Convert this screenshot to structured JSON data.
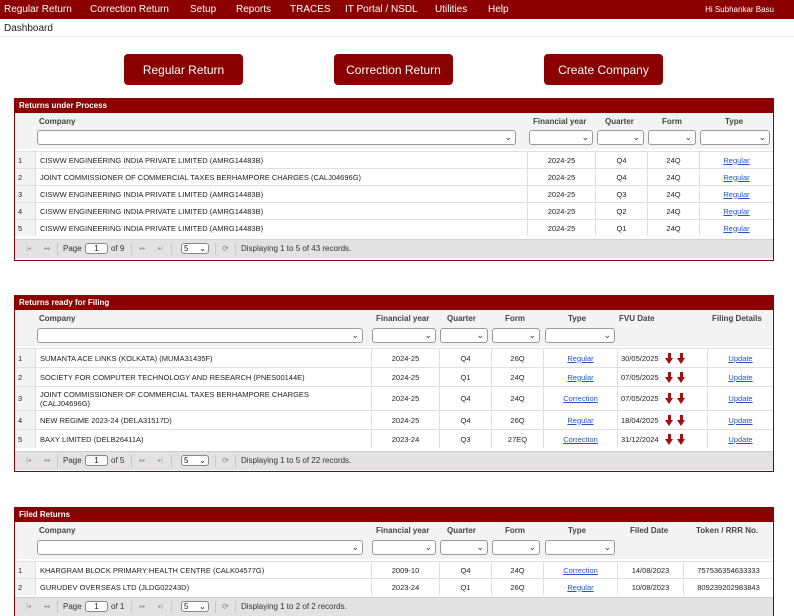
{
  "menu": {
    "items": [
      "Regular Return",
      "Correction Return",
      "Setup",
      "Reports",
      "TRACES",
      "IT Portal / NSDL",
      "Utilities",
      "Help"
    ],
    "user": "Hi Subhankar Basu"
  },
  "breadcrumb": "Dashboard",
  "buttons": {
    "regular": "Regular Return",
    "correction": "Correction Return",
    "create": "Create Company"
  },
  "icons": {
    "dropdown": "chevron-down-icon",
    "fvu_download": "download-arrow-icon",
    "refresh": "refresh-icon"
  },
  "colors": {
    "brand": "#8b0000",
    "link": "#2255cc"
  },
  "pager_icons": [
    "|◂",
    "◂◂",
    "▸▸",
    "▸|",
    "⟳"
  ],
  "chevron": "⌄",
  "process": {
    "title": "Returns under Process",
    "headers": {
      "company": "Company",
      "fy": "Financial year",
      "quarter": "Quarter",
      "form": "Form",
      "type": "Type"
    },
    "rows": [
      {
        "n": "1",
        "company": "CISWW ENGINEERING INDIA PRIVATE LIMITED (AMRG14483B)",
        "fy": "2024-25",
        "q": "Q4",
        "form": "24Q",
        "type": "Regular"
      },
      {
        "n": "2",
        "company": "JOINT COMMISSIONER OF COMMERCIAL TAXES BERHAMPORE CHARGES (CALJ04696G)",
        "fy": "2024-25",
        "q": "Q4",
        "form": "24Q",
        "type": "Regular"
      },
      {
        "n": "3",
        "company": "CISWW ENGINEERING INDIA PRIVATE LIMITED (AMRG14483B)",
        "fy": "2024-25",
        "q": "Q3",
        "form": "24Q",
        "type": "Regular"
      },
      {
        "n": "4",
        "company": "CISWW ENGINEERING INDIA PRIVATE LIMITED (AMRG14483B)",
        "fy": "2024-25",
        "q": "Q2",
        "form": "24Q",
        "type": "Regular"
      },
      {
        "n": "5",
        "company": "CISWW ENGINEERING INDIA PRIVATE LIMITED (AMRG14483B)",
        "fy": "2024-25",
        "q": "Q1",
        "form": "24Q",
        "type": "Regular"
      }
    ],
    "pager": {
      "page_label": "Page",
      "page": "1",
      "of": "of 9",
      "size": "5",
      "status": "Displaying 1 to 5 of 43 records."
    }
  },
  "filing": {
    "title": "Returns ready for Filing",
    "headers": {
      "company": "Company",
      "fy": "Financial year",
      "quarter": "Quarter",
      "form": "Form",
      "type": "Type",
      "fvu": "FVU Date",
      "details": "Filing Details"
    },
    "rows": [
      {
        "n": "1",
        "company": "SUMANTA ACE LINKS (KOLKATA) (MUMA31435F)",
        "fy": "2024-25",
        "q": "Q4",
        "form": "26Q",
        "type": "Regular",
        "fvu": "30/05/2025",
        "details": "Update"
      },
      {
        "n": "2",
        "company": "SOCIETY FOR COMPUTER TECHNOLOGY AND RESEARCH (PNES00144E)",
        "fy": "2024-25",
        "q": "Q1",
        "form": "24Q",
        "type": "Regular",
        "fvu": "07/05/2025",
        "details": "Update"
      },
      {
        "n": "3",
        "company": "JOINT COMMISSIONER OF COMMERCIAL TAXES BERHAMPORE CHARGES (CALJ04696G)",
        "fy": "2024-25",
        "q": "Q4",
        "form": "24Q",
        "type": "Correction",
        "fvu": "07/05/2025",
        "details": "Update"
      },
      {
        "n": "4",
        "company": "NEW REGIME 2023-24 (DELA31517D)",
        "fy": "2024-25",
        "q": "Q4",
        "form": "26Q",
        "type": "Regular",
        "fvu": "18/04/2025",
        "details": "Update"
      },
      {
        "n": "5",
        "company": "BAXY LIMITED (DELB26411A)",
        "fy": "2023-24",
        "q": "Q3",
        "form": "27EQ",
        "type": "Correction",
        "fvu": "31/12/2024",
        "details": "Update"
      }
    ],
    "pager": {
      "page_label": "Page",
      "page": "1",
      "of": "of 5",
      "size": "5",
      "status": "Displaying 1 to 5 of 22 records."
    }
  },
  "filed": {
    "title": "Filed Returns",
    "headers": {
      "company": "Company",
      "fy": "Financial year",
      "quarter": "Quarter",
      "form": "Form",
      "type": "Type",
      "filed": "Filed Date",
      "token": "Token / RRR No."
    },
    "rows": [
      {
        "n": "1",
        "company": "KHARGRAM BLOCK PRIMARY HEALTH CENTRE (CALK04577G)",
        "fy": "2009-10",
        "q": "Q4",
        "form": "24Q",
        "type": "Correction",
        "filed": "14/08/2023",
        "token": "757536354633333"
      },
      {
        "n": "2",
        "company": "GURUDEV OVERSEAS LTD (JLDG02243D)",
        "fy": "2023-24",
        "q": "Q1",
        "form": "26Q",
        "type": "Regular",
        "filed": "10/08/2023",
        "token": "809239202983843"
      }
    ],
    "pager": {
      "page_label": "Page",
      "page": "1",
      "of": "of 1",
      "size": "5",
      "status": "Displaying 1 to 2 of 2 records."
    }
  }
}
